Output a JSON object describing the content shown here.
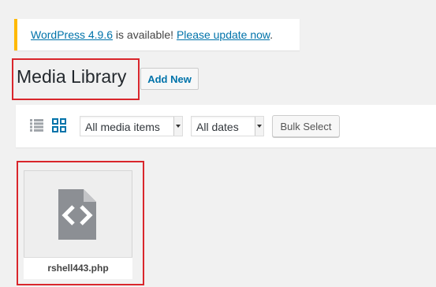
{
  "notice": {
    "version_link": "WordPress 4.9.6",
    "middle_text": " is available! ",
    "update_link": "Please update now",
    "end_text": "."
  },
  "header": {
    "title": "Media Library",
    "add_new_label": "Add New"
  },
  "toolbar": {
    "list_view_icon": "list-view-icon",
    "grid_view_icon": "grid-view-icon",
    "media_filter_selected": "All media items",
    "date_filter_selected": "All dates",
    "bulk_select_label": "Bulk Select"
  },
  "media_items": [
    {
      "icon": "code-file-icon",
      "filename": "rshell443.php"
    }
  ],
  "colors": {
    "notice_accent": "#ffb900",
    "link": "#0073aa",
    "highlight_border": "#d9262c",
    "background": "#f1f1f1"
  }
}
